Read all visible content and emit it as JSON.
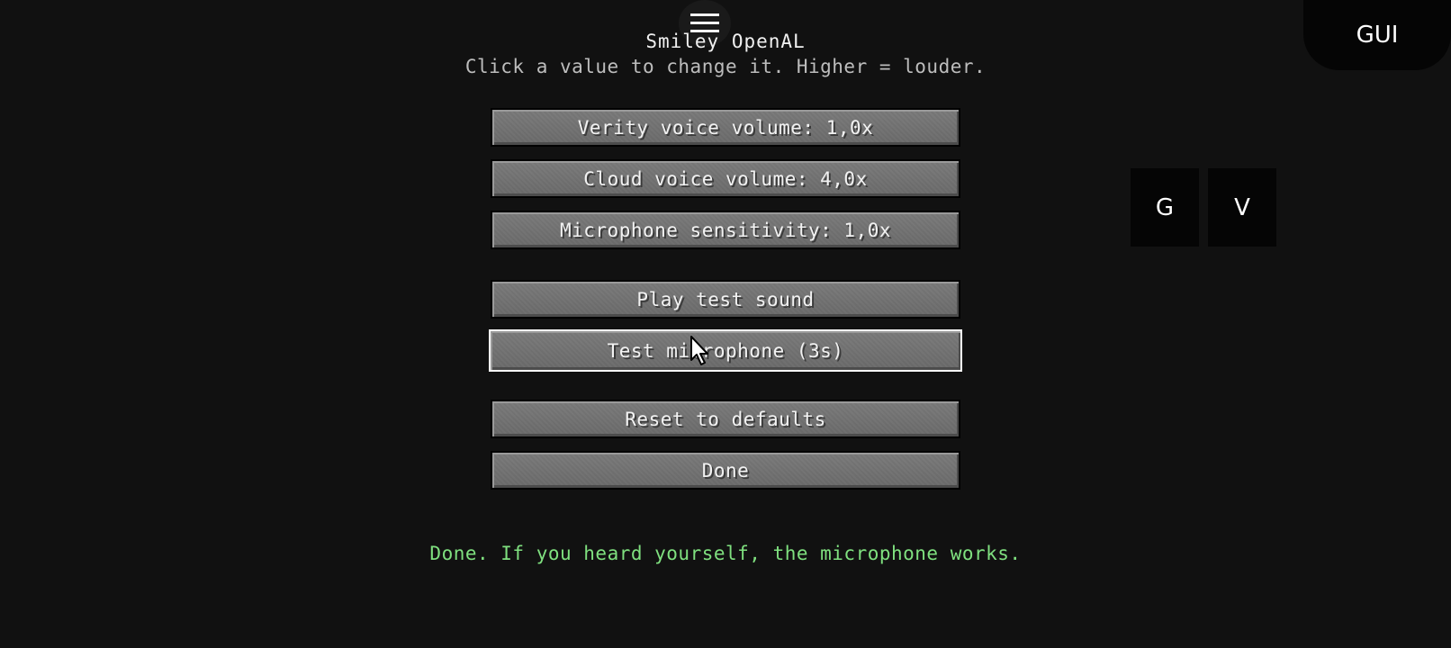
{
  "header": {
    "title": "Smiley OpenAL",
    "subtitle": "Click a value to change it. Higher = louder."
  },
  "buttons": {
    "verity_volume": "Verity voice volume: 1,0x",
    "cloud_volume": "Cloud voice volume: 4,0x",
    "mic_sensitivity": "Microphone sensitivity: 1,0x",
    "play_test": "Play test sound",
    "test_mic": "Test microphone (3s)",
    "reset": "Reset to defaults",
    "done": "Done"
  },
  "status": {
    "message": "Done. If you heard yourself, the microphone works.",
    "color": "#7fe07f"
  },
  "overlay": {
    "gui_label": "GUI",
    "g_label": "G",
    "v_label": "V",
    "menu_icon": "hamburger-menu-icon"
  }
}
